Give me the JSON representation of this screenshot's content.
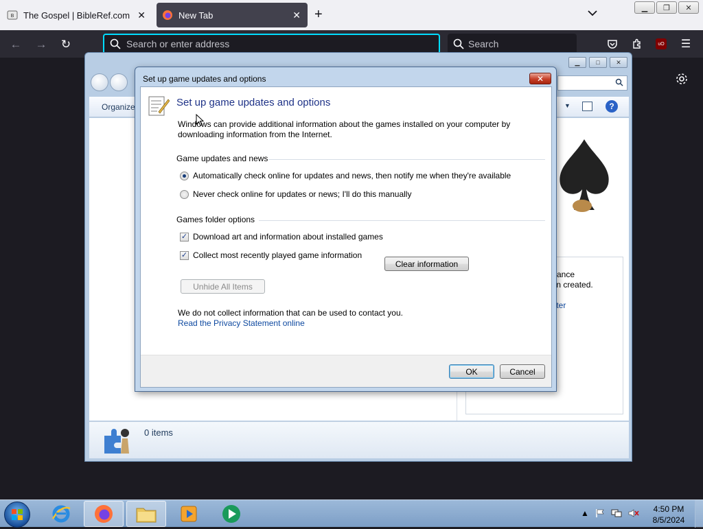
{
  "browser": {
    "tabs": [
      {
        "title": "The Gospel | BibleRef.com",
        "active": false
      },
      {
        "title": "New Tab",
        "active": true
      }
    ],
    "address_placeholder": "Search or enter address",
    "search_placeholder": "Search"
  },
  "games_window": {
    "toolbar": {
      "organize": "Organize"
    },
    "side_text": "rmance\neen created.",
    "side_text_line1": "rmance",
    "side_text_line2": "een created.",
    "side_link1": "puter",
    "side_link2": "e",
    "item_count": "0 items"
  },
  "dialog": {
    "title": "Set up game updates and options",
    "heading": "Set up game updates and options",
    "intro": "Windows can provide additional information about the games installed on your computer by downloading information from the Internet.",
    "updates_group": {
      "title": "Game updates and news",
      "option_auto": "Automatically check online for updates and news, then notify me when they're available",
      "option_never": "Never check online for updates or news; I'll do this manually",
      "selected": "auto"
    },
    "folder_group": {
      "title": "Games folder options",
      "download_art": "Download art and information about installed games",
      "download_art_checked": true,
      "collect_recent": "Collect most recently played game information",
      "collect_recent_checked": true,
      "clear_button": "Clear information",
      "unhide_button": "Unhide All Items"
    },
    "privacy_note": "We do not collect information that can be used to contact you.",
    "privacy_link": "Read the Privacy Statement online",
    "ok": "OK",
    "cancel": "Cancel"
  },
  "taskbar": {
    "time": "4:50 PM",
    "date": "8/5/2024"
  }
}
